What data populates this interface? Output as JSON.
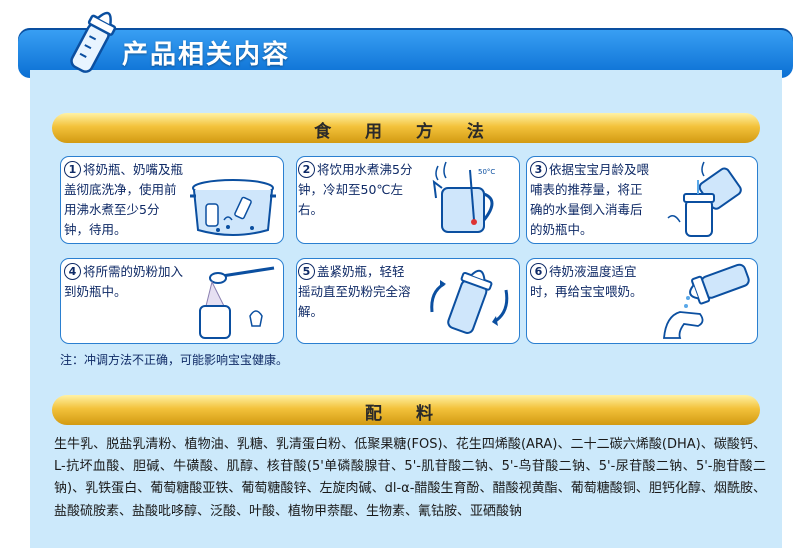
{
  "header": {
    "title": "产品相关内容"
  },
  "usage": {
    "title": "食 用 方 法",
    "steps": [
      {
        "num": "1",
        "text": "将奶瓶、奶嘴及瓶盖彻底洗净，使用前用沸水煮至少5分钟，待用。"
      },
      {
        "num": "2",
        "text": "将饮用水煮沸5分钟，冷却至50℃左右。"
      },
      {
        "num": "3",
        "text": "依据宝宝月龄及喂哺表的推荐量，将正确的水量倒入消毒后的奶瓶中。"
      },
      {
        "num": "4",
        "text": "将所需的奶粉加入到奶瓶中。"
      },
      {
        "num": "5",
        "text": "盖紧奶瓶，轻轻摇动直至奶粉完全溶解。"
      },
      {
        "num": "6",
        "text": "待奶液温度适宜时，再给宝宝喂奶。"
      }
    ],
    "note": "注：冲调方法不正确，可能影响宝宝健康。",
    "kettle_label": "50°C"
  },
  "ingredients": {
    "title": "配 料",
    "text": "生牛乳、脱盐乳清粉、植物油、乳糖、乳清蛋白粉、低聚果糖(FOS)、花生四烯酸(ARA)、二十二碳六烯酸(DHA)、碳酸钙、L-抗坏血酸、胆碱、牛磺酸、肌醇、核苷酸(5'单磷酸腺苷、5'-肌苷酸二钠、5'-鸟苷酸二钠、5'-尿苷酸二钠、5'-胞苷酸二钠)、乳铁蛋白、葡萄糖酸亚铁、葡萄糖酸锌、左旋肉碱、dl-α-醋酸生育酚、醋酸视黄酯、葡萄糖酸铜、胆钙化醇、烟酰胺、盐酸硫胺素、盐酸吡哆醇、泛酸、叶酸、植物甲萘醌、生物素、氰钴胺、亚硒酸钠"
  },
  "colors": {
    "header_blue": "#1a86e6",
    "panel_bg": "#cce9fb",
    "band_gold": "#f3c23b",
    "card_border": "#2a7fd0",
    "text_navy": "#0f2a66"
  }
}
